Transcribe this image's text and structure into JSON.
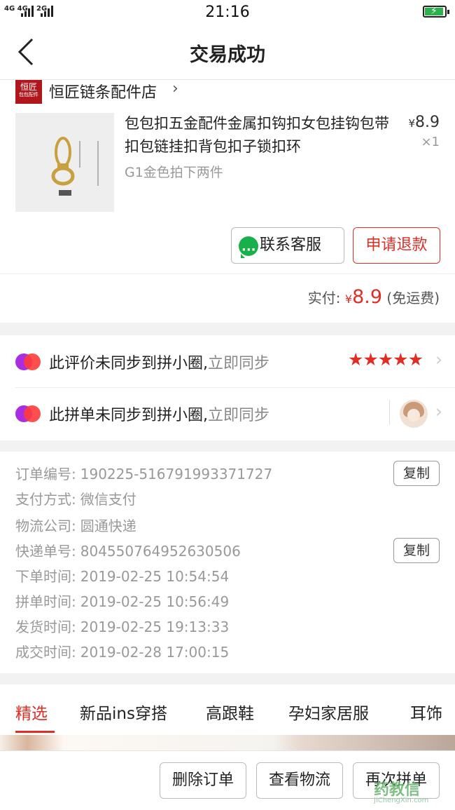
{
  "status_bar": {
    "network_1": "4G 4G",
    "network_2": "2G",
    "time": "21:16",
    "battery_color": "#2bb24c"
  },
  "nav": {
    "back_icon": "chevron-left-icon",
    "title": "交易成功"
  },
  "shop": {
    "logo_line1": "恒匠",
    "logo_line2": "包包配件",
    "name": "恒匠链条配件店",
    "arrow": "›"
  },
  "item": {
    "title": "包包扣五金配件金属扣钩扣女包挂钩包带扣包链挂扣背包扣子锁扣环",
    "price_symbol": "¥",
    "price": "8.9",
    "quantity": "×1",
    "spec": "G1金色拍下两件"
  },
  "actions": {
    "contact_label": "联系客服",
    "refund_label": "申请退款"
  },
  "payment": {
    "label": "实付:",
    "symbol": "¥",
    "amount": "8.9",
    "note": "(免运费)"
  },
  "sync": {
    "review_text": "此评价未同步到拼小圈,",
    "review_link": "立即同步",
    "stars": "★★★★★",
    "rating": 5,
    "order_text": "此拼单未同步到拼小圈,",
    "order_link": "立即同步",
    "chevron": "›"
  },
  "order_info": {
    "rows": [
      {
        "label": "订单编号:",
        "value": "190225-516791993371727"
      },
      {
        "label": "支付方式:",
        "value": "微信支付"
      },
      {
        "label": "物流公司:",
        "value": "圆通快递"
      },
      {
        "label": "快递单号:",
        "value": "804550764952630506"
      },
      {
        "label": "下单时间:",
        "value": "2019-02-25 10:54:54"
      },
      {
        "label": "拼单时间:",
        "value": "2019-02-25 10:56:49"
      },
      {
        "label": "发货时间:",
        "value": "2019-02-25 19:13:33"
      },
      {
        "label": "成交时间:",
        "value": "2019-02-28 17:00:15"
      }
    ],
    "copy_label": "复制"
  },
  "tabs": [
    "精选",
    "新品ins穿搭",
    "高跟鞋",
    "孕妇家居服",
    "耳饰"
  ],
  "bottom_actions": {
    "delete_label": "删除订单",
    "logistics_label": "查看物流",
    "reorder_label": "再次拼单"
  },
  "watermark": {
    "logo": "药教信",
    "url": "JiChengXin.com"
  },
  "colors": {
    "accent_red": "#e02e24",
    "wechat_green": "#17b04a",
    "gap_gray": "#f2f2f2"
  }
}
